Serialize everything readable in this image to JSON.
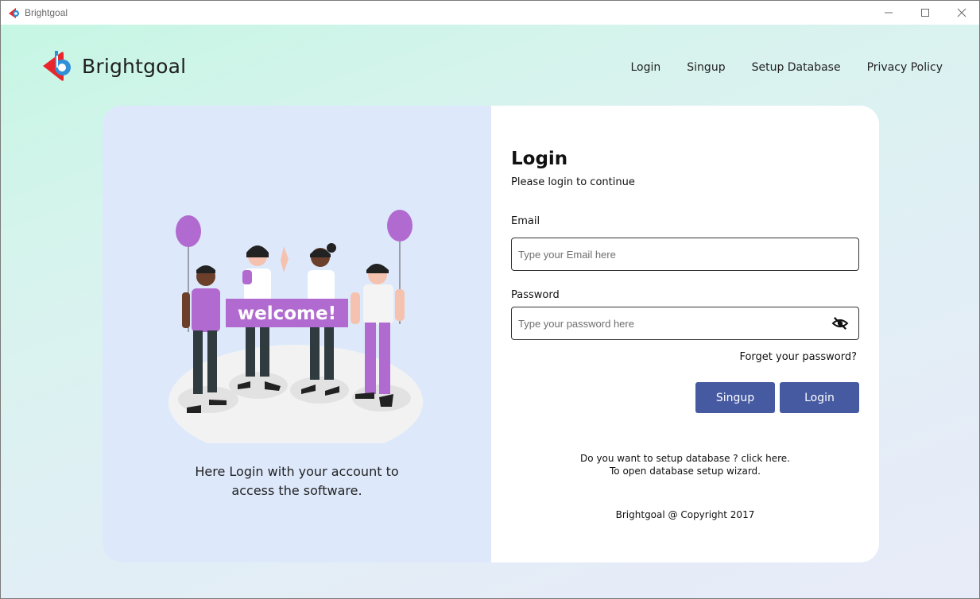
{
  "window": {
    "title": "Brightgoal",
    "minimize_icon": "minimize-icon",
    "maximize_icon": "maximize-icon",
    "close_icon": "close-icon"
  },
  "header": {
    "brand_name": "Brightgoal",
    "logo_icon": "brightgoal-logo",
    "nav": [
      {
        "label": "Login"
      },
      {
        "label": "Singup"
      },
      {
        "label": "Setup Database"
      },
      {
        "label": "Privacy Policy"
      }
    ]
  },
  "left_panel": {
    "banner_text": "welcome!",
    "caption_line1": "Here Login with your account to",
    "caption_line2": "access the software."
  },
  "form": {
    "title": "Login",
    "subtitle": "Please login to continue",
    "email_label": "Email",
    "email_placeholder": "Type your Email here",
    "email_value": "",
    "password_label": "Password",
    "password_placeholder": "Type your password here",
    "password_value": "",
    "eye_icon": "eye-slash-icon",
    "forgot_link": "Forget your password?",
    "signup_button": "Singup",
    "login_button": "Login",
    "setup_line1": "Do you want to setup database ? click here.",
    "setup_line2": "To open database setup wizard.",
    "copyright": "Brightgoal @ Copyright 2017"
  },
  "colors": {
    "button": "#465aa2",
    "left_panel_bg": "#dde9fb",
    "balloon": "#b16bd0",
    "logo_red": "#e8262b",
    "logo_blue": "#2f8fd8"
  }
}
